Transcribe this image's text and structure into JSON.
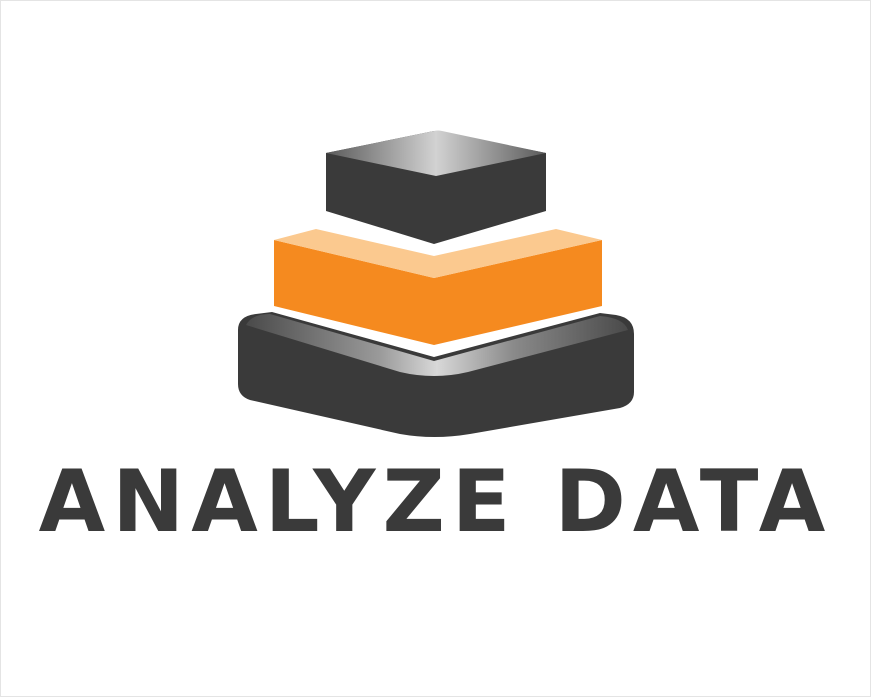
{
  "logo": {
    "text": "ANALYZE DATA",
    "colors": {
      "dark": "#3a3a3a",
      "dark_top_light": "#c8c8c8",
      "orange": "#f58a1f",
      "orange_top": "#fbc98f",
      "background": "#ffffff"
    },
    "icon": "stacked-layers-icon"
  }
}
